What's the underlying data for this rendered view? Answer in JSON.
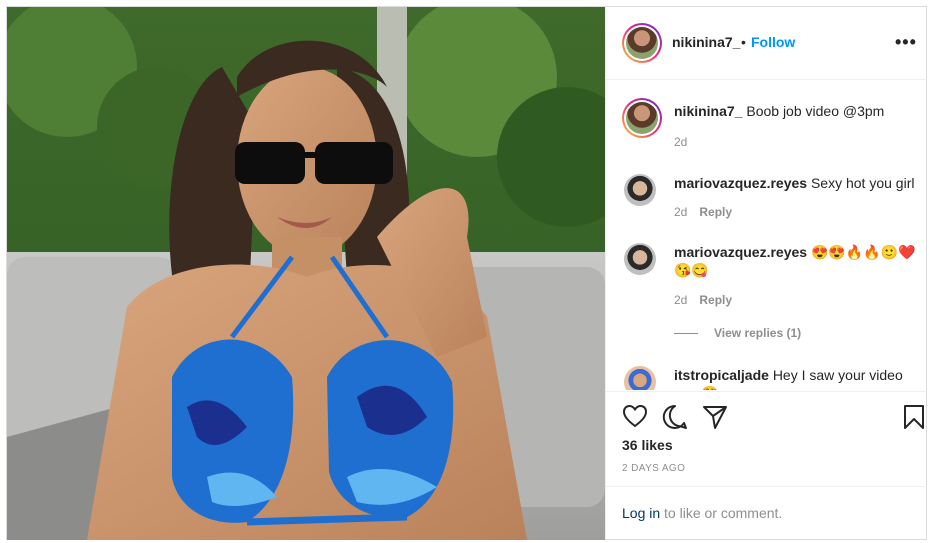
{
  "post": {
    "username": "nikinina7_",
    "follow_label": "Follow",
    "dot": "•",
    "more": "•••"
  },
  "caption": {
    "username": "nikinina7_",
    "text": "Boob job video @3pm",
    "time": "2d"
  },
  "comments": [
    {
      "username": "mariovazquez.reyes",
      "text": "Sexy hot you girl",
      "time": "2d",
      "reply_label": "Reply"
    },
    {
      "username": "mariovazquez.reyes",
      "text_line1": "😍😍🔥🔥🙂❤️",
      "text_line2": "😘😋",
      "time": "2d",
      "reply_label": "Reply",
      "view_replies": "View replies (1)"
    },
    {
      "username": "itstropicaljade",
      "text_line1": "Hey I saw your video",
      "text_line2": "...... 😍"
    }
  ],
  "actions": {
    "likes": "36 likes",
    "posted_ago": "2 DAYS AGO"
  },
  "login": {
    "link": "Log in",
    "rest": " to like or comment."
  },
  "colors": {
    "accent": "#0095f6",
    "link": "#00376b",
    "muted": "#8e8e8e",
    "text": "#262626"
  }
}
